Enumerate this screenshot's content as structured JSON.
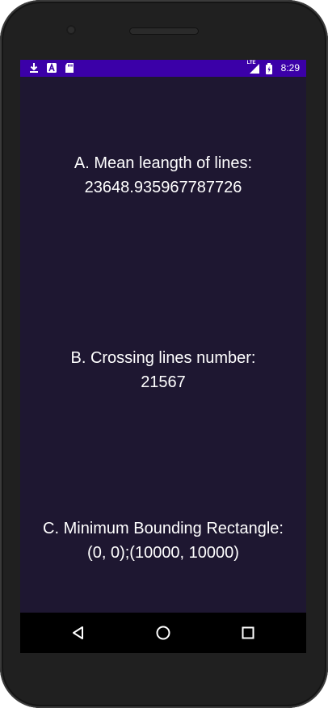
{
  "status_bar": {
    "time": "8:29",
    "network_label": "LTE",
    "left_icons": [
      "download-icon",
      "text-app-icon",
      "sd-card-icon"
    ],
    "right_icons": [
      "signal-icon",
      "battery-icon"
    ]
  },
  "results": {
    "a_label": "A. Mean leangth of lines:",
    "a_value": "23648.935967787726",
    "b_label": "B. Crossing lines number:",
    "b_value": "21567",
    "c_label": "C. Minimum Bounding Rectangle:",
    "c_value": "(0, 0);(10000, 10000)"
  },
  "nav_bar": {
    "buttons": [
      "back-icon",
      "home-icon",
      "recents-icon"
    ]
  },
  "colors": {
    "background": "#1e1731",
    "status_bar": "#3b00a8",
    "text": "#ffffff",
    "nav_bar": "#000000"
  }
}
